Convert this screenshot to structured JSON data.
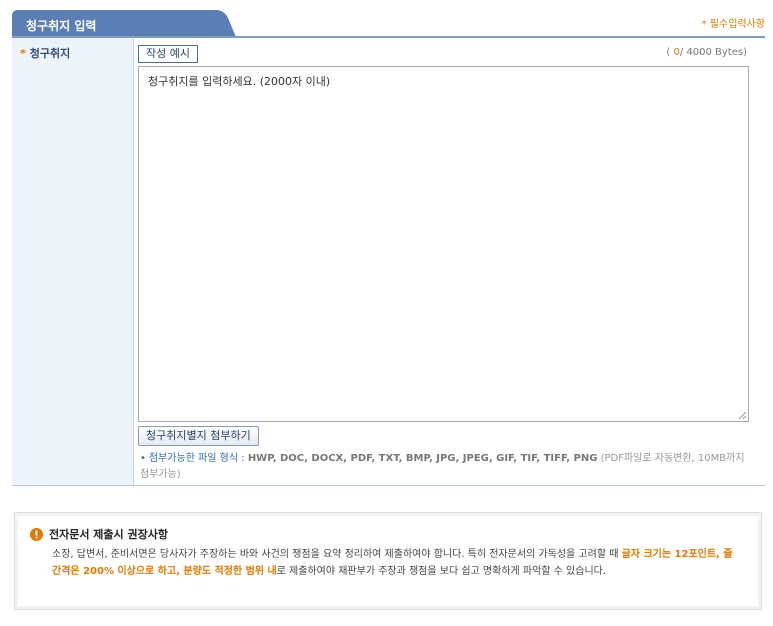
{
  "tab": {
    "title": "청구취지 입력",
    "required_note": "* 필수입력사항"
  },
  "form": {
    "field_label": "청구취지",
    "required_mark": "*",
    "example_button": "작성 예시",
    "byte_count": {
      "open": "(",
      "current": "0",
      "separator": "/",
      "max": "4000 Bytes)"
    },
    "textarea_value": "청구취지를 입력하세요. (2000자 이내)",
    "attach_button": "청구취지별지 첨부하기",
    "file_note": {
      "bullet": "•",
      "label": "첨부가능한 파일 형식 :",
      "types": "HWP, DOC, DOCX, PDF, TXT, BMP, JPG, JPEG, GIF, TIF, TIFF, PNG",
      "suffix": "(PDF파일로 자동변환, 10MB까지 첨부가능)"
    }
  },
  "notice": {
    "title": "전자문서 제출시 권장사항",
    "body_1": "소장, 답변서, 준비서면은 당사자가 주장하는 바와 사건의 쟁점을 요약 정리하여 제출하여야 합니다. 특히 전자문서의 가독성을 고려할 때 ",
    "highlight": "글자 크기는 12포인트, 줄 간격은 200% 이상으로 하고, 분량도 적정한 범위 내",
    "body_2": "로 제출하여야 재판부가 주장과 쟁점을 보다 쉽고 명확하게 파악할 수 있습니다."
  },
  "colors": {
    "tab_fill": "#5b7fb5",
    "accent_orange": "#e07a00",
    "link_blue": "#2f6fb7",
    "notice_icon": "#e07a00"
  },
  "icons": {
    "notice": "exclamation-circle-icon",
    "resize": "resize-grip-icon"
  }
}
